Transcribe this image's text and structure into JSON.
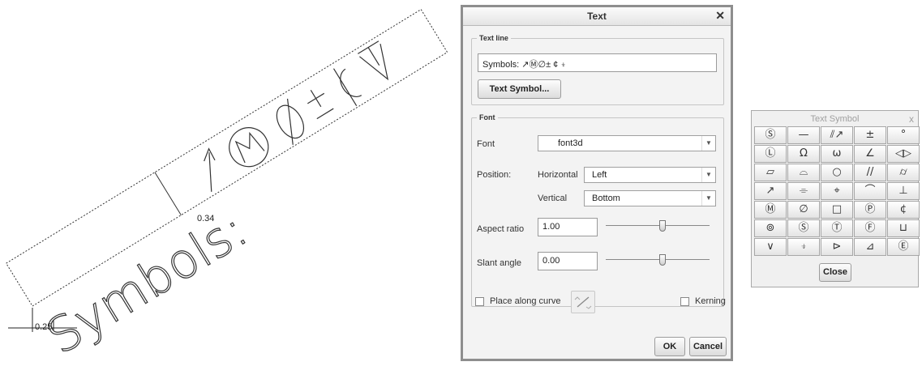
{
  "sketch": {
    "main_text": "Symbols:",
    "dim_height": "0.34",
    "dim_origin": "0.25"
  },
  "text_dialog": {
    "title": "Text",
    "close_glyph": "✕",
    "text_line_group": "Text line",
    "text_line_value": "Symbols: ↗Ⓜ∅± ¢ ⍖",
    "text_symbol_button": "Text Symbol...",
    "font_group": "Font",
    "font_label": "Font",
    "font_value": "font3d",
    "position_label": "Position:",
    "horizontal_label": "Horizontal",
    "horizontal_value": "Left",
    "vertical_label": "Vertical",
    "vertical_value": "Bottom",
    "aspect_label": "Aspect ratio",
    "aspect_value": "1.00",
    "aspect_slider_fraction": 0.55,
    "slant_label": "Slant angle",
    "slant_value": "0.00",
    "slant_slider_fraction": 0.55,
    "place_along_curve_label": "Place along curve",
    "kerning_label": "Kerning",
    "ok_label": "OK",
    "cancel_label": "Cancel",
    "dropdown_arrow": "▼"
  },
  "symbol_palette": {
    "title": "Text Symbol",
    "close_glyph": "x",
    "symbols": [
      "Ⓢ",
      "—",
      "⫽↗",
      "±",
      "°",
      "Ⓛ",
      "Ω",
      "ω",
      "∠",
      "◁▷",
      "▱",
      "⌓",
      "○",
      "//",
      "⌭",
      "↗",
      "⌯",
      "⌖",
      "⌒",
      "⊥",
      "Ⓜ",
      "∅",
      "□",
      "Ⓟ",
      "¢",
      "⊚",
      "Ⓢ",
      "Ⓣ",
      "Ⓕ",
      "⊔",
      "∨",
      "⍖",
      "⊳",
      "⊿",
      "Ⓔ"
    ],
    "close_label": "Close"
  }
}
